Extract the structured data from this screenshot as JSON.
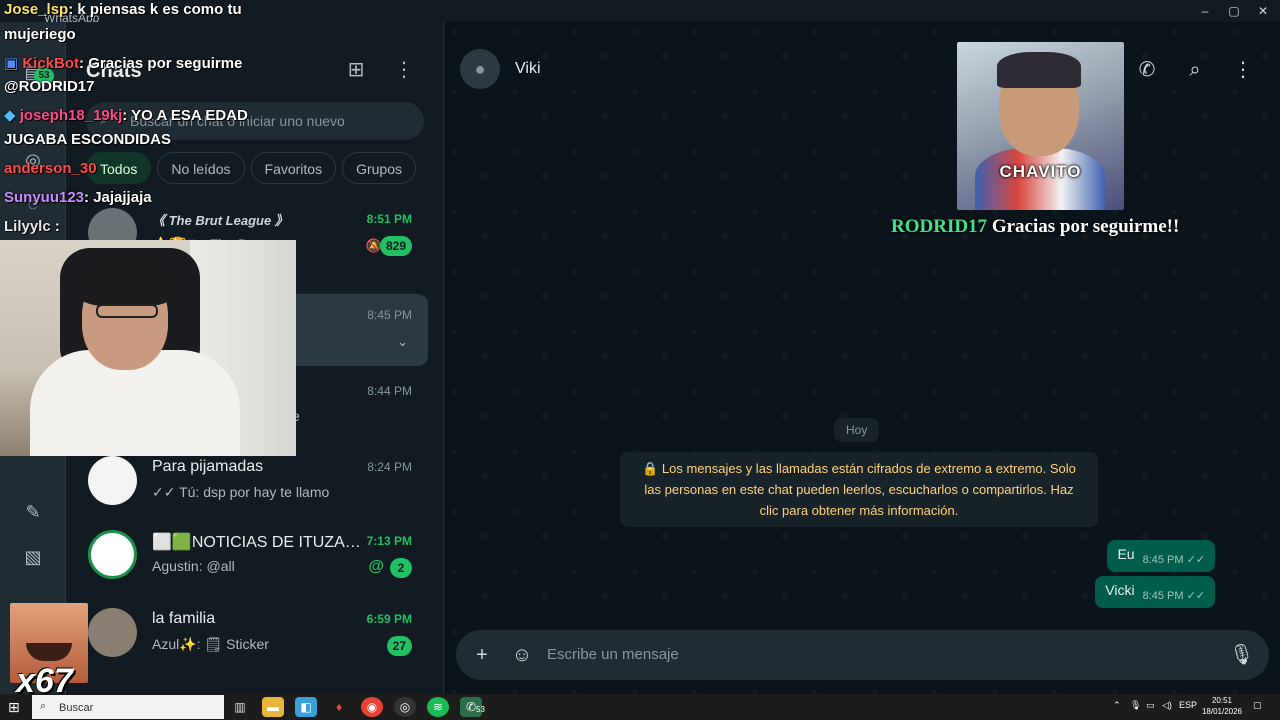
{
  "window": {
    "title": "WhatsApp",
    "controls": {
      "minimize": "‒",
      "maximize": "▢",
      "close": "✕"
    }
  },
  "rail": {
    "unread_badge": "53"
  },
  "chat_list": {
    "title": "Chats",
    "search_placeholder": "Buscar un chat o iniciar uno nuevo",
    "filters": [
      "Todos",
      "No leídos",
      "Favoritos",
      "Grupos"
    ],
    "rows": [
      {
        "name": "《 The Brut League 》",
        "time": "8:51 PM",
        "message": "⭐🏆#...  The Br...",
        "badge": "829",
        "muted": true,
        "unread": true
      },
      {
        "name": "",
        "time": "8:45 PM",
        "message": "",
        "selected": true
      },
      {
        "name": "",
        "time": "8:44 PM",
        "message": "e"
      },
      {
        "name": "Para pijamadas",
        "time": "8:24 PM",
        "message": "✓✓ Tú: dsp por hay te llamo"
      },
      {
        "name": "⬜🟩NOTICIAS DE ITUZAI...",
        "time": "7:13 PM",
        "message": "Agustin: @all",
        "badge": "2",
        "mention": "@",
        "unread": true
      },
      {
        "name": "la familia",
        "time": "6:59 PM",
        "message": "Azul✨: 🗒 Sticker",
        "badge": "27",
        "unread": true
      }
    ]
  },
  "conversation": {
    "contact_name": "Viki",
    "day_separator": "Hoy",
    "encryption_notice": "🔒 Los mensajes y las llamadas están cifrados de extremo a extremo. Solo las personas en este chat pueden leerlos, escucharlos o compartirlos. Haz clic para obtener más información.",
    "messages": [
      {
        "text": "Eu",
        "time": "8:45 PM",
        "ticks": "✓✓"
      },
      {
        "text": "Vicki",
        "time": "8:45 PM",
        "ticks": "✓✓"
      }
    ],
    "composer_placeholder": "Escribe un mensaje"
  },
  "stream_overlay": {
    "alert_caption": "CHAVITO",
    "alert_user": "RODRID17",
    "alert_message": " Gracias por seguirme!!",
    "chat": [
      {
        "user": "Jose_lsp",
        "color": "#ffe16b",
        "text": ": k piensas k es como tu"
      },
      {
        "user": "",
        "color": "#ffffff",
        "text": "mujeriego"
      },
      {
        "user": "KickBot",
        "color": "#ff4b4b",
        "text": ": Gracias por seguirme"
      },
      {
        "user": "",
        "color": "#ffffff",
        "text": "@RODRID17"
      },
      {
        "user": "joseph18_19kj",
        "color": "#ff4b8a",
        "text": ": YO A ESA EDAD"
      },
      {
        "user": "",
        "color": "#ffffff",
        "text": "JUGABA ESCONDIDAS"
      },
      {
        "user": "anderson_30",
        "color": "#ff4b4b",
        "text": ""
      },
      {
        "user": "Sunyuu123",
        "color": "#c68cff",
        "text": ": Jajajjaja"
      },
      {
        "user": "Lilyylc",
        "color": "#e8e8e8",
        "text": " :"
      }
    ],
    "emote_counter": "x67"
  },
  "taskbar": {
    "search_placeholder": "Buscar",
    "whatsapp_badge": "53",
    "language": "ESP",
    "time": "20:51",
    "date": "18/01/2026"
  },
  "colors": {
    "accent": "#21c063",
    "outgoing_bubble": "#005c4b",
    "panel_bg": "#111b21",
    "notice_text": "#ffd279"
  }
}
